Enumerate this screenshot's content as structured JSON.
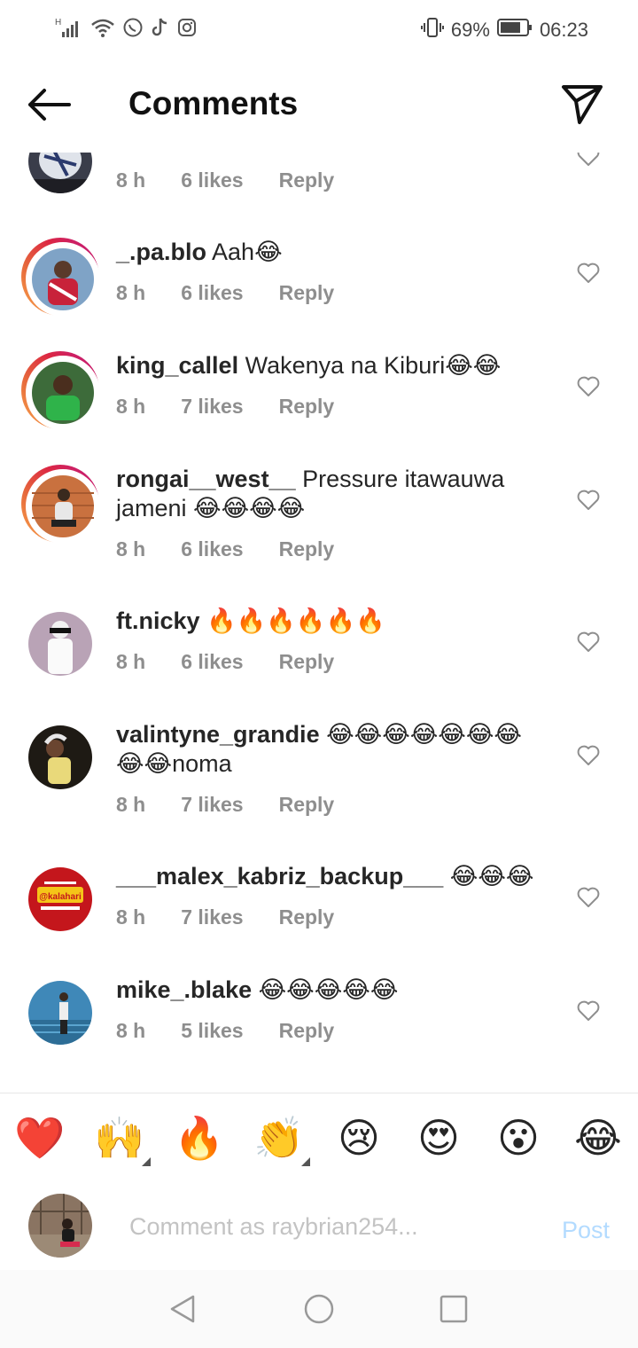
{
  "status_bar": {
    "signal_label": "H",
    "battery_percent": "69%",
    "time": "06:23"
  },
  "header": {
    "title": "Comments"
  },
  "comments": [
    {
      "username": "",
      "text": "",
      "time": "8 h",
      "likes": "6 likes",
      "reply": "Reply"
    },
    {
      "username": "_.pa.blo",
      "text": "Aah😂",
      "time": "8 h",
      "likes": "6 likes",
      "reply": "Reply"
    },
    {
      "username": "king_callel",
      "text": "Wakenya na Kiburi😂😂",
      "time": "8 h",
      "likes": "7 likes",
      "reply": "Reply"
    },
    {
      "username": "rongai__west__",
      "text": "Pressure itawauwa jameni 😂😂😂😂",
      "time": "8 h",
      "likes": "6 likes",
      "reply": "Reply"
    },
    {
      "username": "ft.nicky",
      "text": "🔥🔥🔥🔥🔥🔥",
      "time": "8 h",
      "likes": "6 likes",
      "reply": "Reply"
    },
    {
      "username": "valintyne_grandie",
      "text": "😂😂😂😂😂😂😂😂😂noma",
      "time": "8 h",
      "likes": "7 likes",
      "reply": "Reply"
    },
    {
      "username": "___malex_kabriz_backup___",
      "text": "😂😂😂",
      "time": "8 h",
      "likes": "7 likes",
      "reply": "Reply"
    },
    {
      "username": "mike_.blake",
      "text": "😂😂😂😂😂",
      "time": "8 h",
      "likes": "5 likes",
      "reply": "Reply"
    }
  ],
  "quick_emojis": [
    "❤️",
    "🙌",
    "🔥",
    "👏",
    "😢",
    "😍",
    "😮",
    "😂"
  ],
  "composer": {
    "placeholder": "Comment as raybrian254...",
    "post_label": "Post"
  },
  "avatar_logo_text": "@kalahari",
  "colors": {
    "post_disabled": "#b3dbff",
    "meta_gray": "#8e8e8e",
    "story_ring": "#dc2743"
  }
}
